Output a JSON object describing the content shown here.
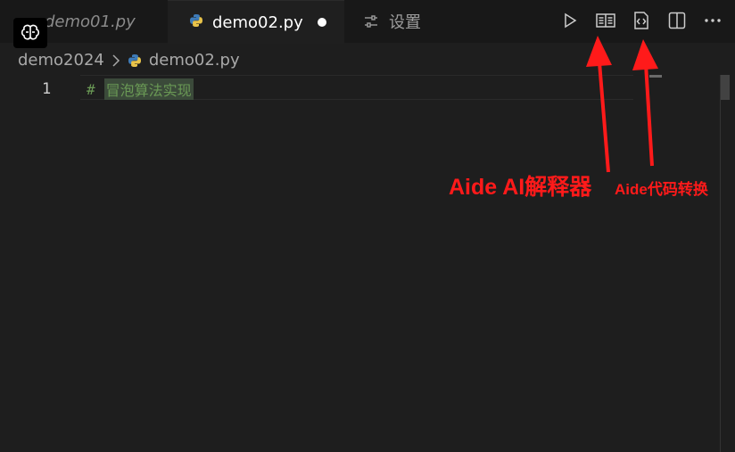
{
  "tabs": [
    {
      "label": "demo01.py",
      "active": false
    },
    {
      "label": "demo02.py",
      "active": true,
      "dirty": true
    },
    {
      "label": "设置",
      "active": false
    }
  ],
  "breadcrumb": {
    "folder": "demo2024",
    "file": "demo02.py"
  },
  "editor": {
    "line_number": "1",
    "comment_hash": "#",
    "comment_text": "冒泡算法实现"
  },
  "annotations": {
    "left": "Aide AI解释器",
    "right": "Aide代码转换"
  },
  "colors": {
    "annotation": "#ff1a1a",
    "comment": "#6a9955",
    "background": "#1e1e1e"
  },
  "icons": [
    "python-icon",
    "settings-sliders-icon",
    "run-icon",
    "book-icon",
    "code-file-icon",
    "split-editor-icon",
    "more-icon",
    "brain-icon"
  ]
}
